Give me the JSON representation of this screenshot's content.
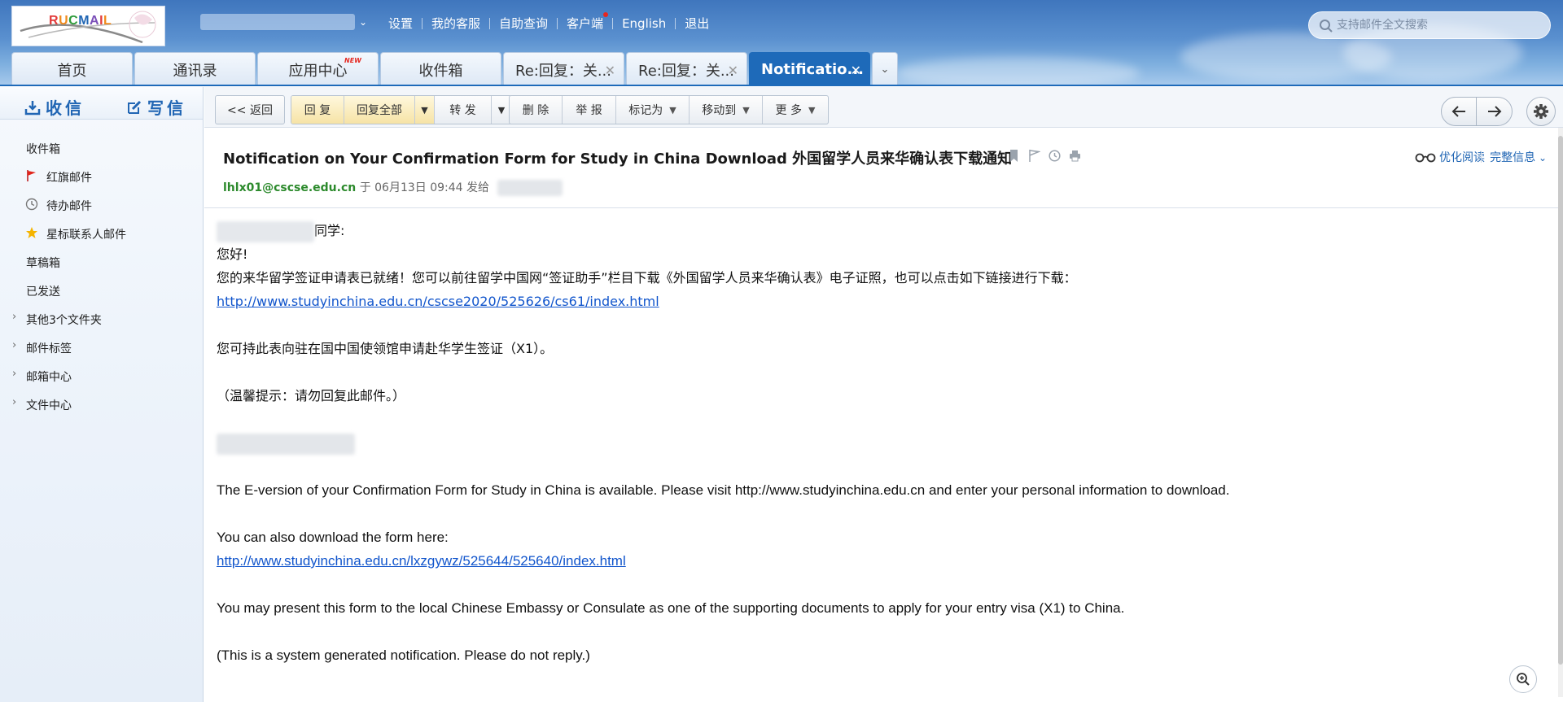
{
  "logo": {
    "text": "RUCMAIL"
  },
  "header": {
    "links": [
      "设置",
      "我的客服",
      "自助查询",
      "客户端",
      "English",
      "退出"
    ],
    "search_placeholder": "支持邮件全文搜索"
  },
  "tabs": [
    {
      "label": "首页"
    },
    {
      "label": "通讯录"
    },
    {
      "label": "应用中心",
      "badge": "NEW"
    },
    {
      "label": "收件箱"
    },
    {
      "label": "Re:回复：关..."
    },
    {
      "label": "Re:回复：关..."
    },
    {
      "label": "Notificatio..."
    }
  ],
  "sidebar": {
    "receive": "收信",
    "compose": "写信",
    "items": [
      {
        "label": "收件箱"
      },
      {
        "label": "红旗邮件"
      },
      {
        "label": "待办邮件"
      },
      {
        "label": "星标联系人邮件"
      },
      {
        "label": "草稿箱"
      },
      {
        "label": "已发送"
      },
      {
        "label": "其他3个文件夹"
      },
      {
        "label": "邮件标签"
      },
      {
        "label": "邮箱中心"
      },
      {
        "label": "文件中心"
      }
    ]
  },
  "toolbar": {
    "back": "<< 返回",
    "reply": "回 复",
    "reply_all": "回复全部",
    "forward": "转 发",
    "delete": "删 除",
    "report": "举 报",
    "mark_as": "标记为",
    "move_to": "移动到",
    "more": "更 多"
  },
  "message": {
    "subject": "Notification on Your Confirmation Form for Study in China Download 外国留学人员来华确认表下载通知",
    "from": "lhlx01@cscse.edu.cn",
    "date_prefix": "于 06月13日 09:44 发给",
    "reader_mode": "优化阅读",
    "full_info": "完整信息",
    "greeting_suffix": "同学:",
    "hello": "您好!",
    "line1": "您的来华留学签证申请表已就绪！您可以前往留学中国网“签证助手”栏目下载《外国留学人员来华确认表》电子证照，也可以点击如下链接进行下载：",
    "link1": "http://www.studyinchina.edu.cn/cscse2020/525626/cs61/index.html",
    "line2": "您可持此表向驻在国中国使领馆申请赴华学生签证（X1）。",
    "line3": "（温馨提示：请勿回复此邮件。）",
    "en1": "The E-version of your Confirmation Form for Study in China is available. Please visit http://www.studyinchina.edu.cn and enter your personal information to download.",
    "en2": "You can also download the form here:",
    "link2": "http://www.studyinchina.edu.cn/lxzgywz/525644/525640/index.html",
    "en3": "You may present this form to the local Chinese Embassy or Consulate as one of the supporting documents to apply for your entry visa (X1) to China.",
    "en4": "(This is a system generated notification. Please do not reply.)"
  }
}
